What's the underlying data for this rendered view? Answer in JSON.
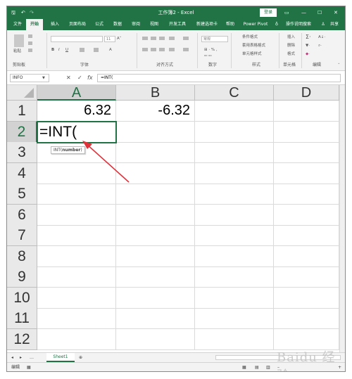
{
  "window": {
    "title": "工作簿2  -  Excel",
    "login_label": "登录"
  },
  "titlebar": {
    "save_icon": "save-icon",
    "undo_icon": "undo-icon",
    "redo_icon": "redo-icon"
  },
  "tabs": [
    "文件",
    "开始",
    "插入",
    "页面布局",
    "公式",
    "数据",
    "审阅",
    "视图",
    "开发工具",
    "新建选项卡",
    "帮助",
    "Power Pivot"
  ],
  "tell_me": "操作说明搜索",
  "share": "共享",
  "ribbon": {
    "groups": [
      "剪贴板",
      "字体",
      "对齐方式",
      "数字",
      "样式",
      "单元格",
      "编辑"
    ],
    "paste_label": "粘贴",
    "font_size": "11",
    "number_format": "常规",
    "styles": [
      "条件格式",
      "套用表格格式",
      "单元格样式"
    ],
    "cells": [
      "插入",
      "删除",
      "格式"
    ]
  },
  "formula_bar": {
    "name_box": "INFO",
    "fx": "fx",
    "cancel": "✕",
    "enter": "✓",
    "formula": "=INT("
  },
  "grid": {
    "columns": [
      "A",
      "B",
      "C",
      "D"
    ],
    "rows": [
      "1",
      "2",
      "3",
      "4",
      "5",
      "6",
      "7",
      "8",
      "9",
      "10",
      "11",
      "12"
    ],
    "cells": {
      "A1": "6.32",
      "B1": "-6.32",
      "A2": "=INT("
    },
    "tooltip": {
      "fn": "INT(",
      "arg": "number",
      "close": ")"
    }
  },
  "sheets": [
    "Sheet1"
  ],
  "status": {
    "mode": "编辑",
    "zoom": "+"
  },
  "watermark": "Baidu 经验",
  "colors": {
    "accent": "#217346",
    "arrow": "#e0303a"
  }
}
